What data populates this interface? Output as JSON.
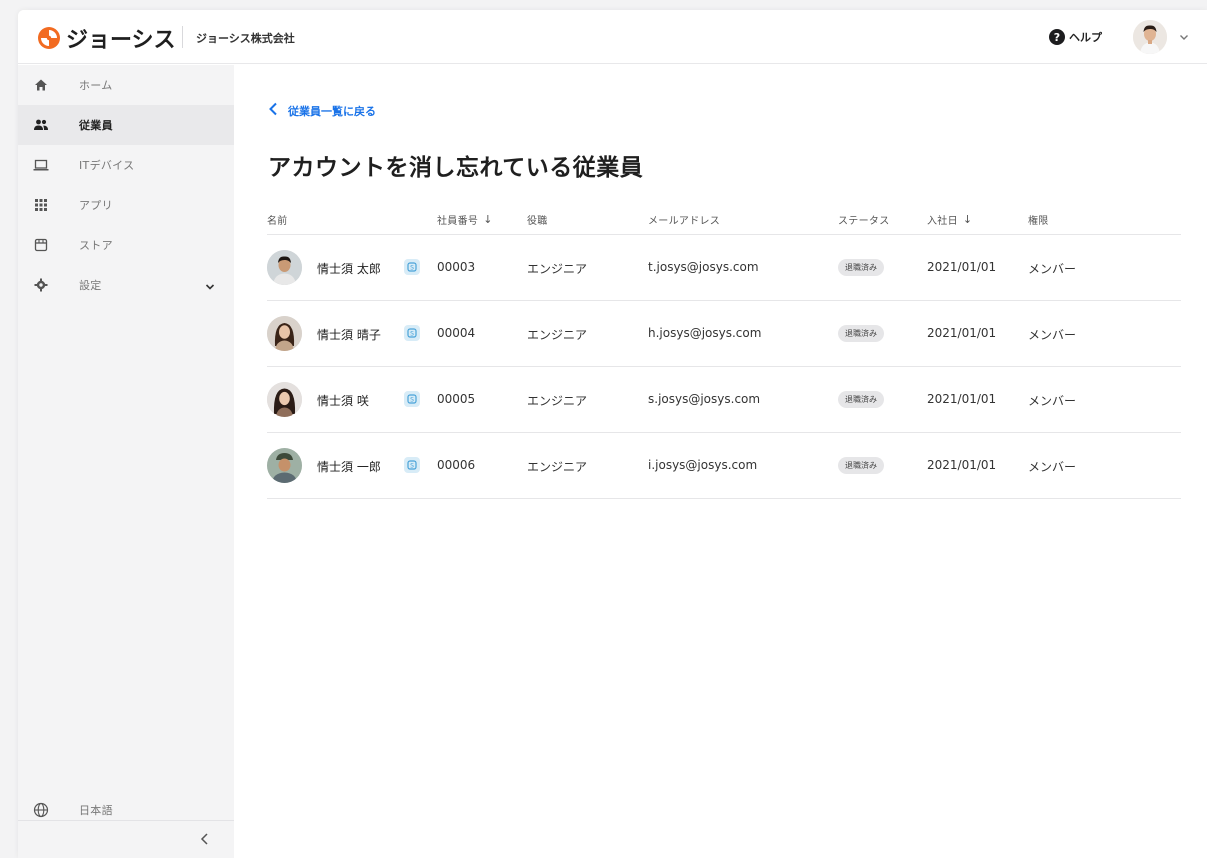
{
  "header": {
    "logo_text": "ジョーシス",
    "company": "ジョーシス株式会社",
    "help_label": "ヘルプ",
    "help_icon_glyph": "?"
  },
  "sidebar": {
    "items": [
      {
        "label": "ホーム",
        "icon": "home-icon"
      },
      {
        "label": "従業員",
        "icon": "people-icon",
        "active": true
      },
      {
        "label": "ITデバイス",
        "icon": "laptop-icon"
      },
      {
        "label": "アプリ",
        "icon": "apps-grid-icon"
      },
      {
        "label": "ストア",
        "icon": "store-icon"
      },
      {
        "label": "設定",
        "icon": "gear-icon",
        "expandable": true
      }
    ],
    "language": "日本語"
  },
  "main": {
    "back_link": "従業員一覧に戻る",
    "title": "アカウントを消し忘れている従業員",
    "columns": {
      "name": "名前",
      "employee_no": "社員番号",
      "role": "役職",
      "email": "メールアドレス",
      "status": "ステータス",
      "joined": "入社日",
      "permission": "権限",
      "sort_glyph": "↓"
    },
    "rows": [
      {
        "name": "情士須 太郎",
        "employee_no": "00003",
        "role": "エンジニア",
        "email": "t.josys@josys.com",
        "status": "退職済み",
        "joined": "2021/01/01",
        "permission": "メンバー"
      },
      {
        "name": "情士須 晴子",
        "employee_no": "00004",
        "role": "エンジニア",
        "email": "h.josys@josys.com",
        "status": "退職済み",
        "joined": "2021/01/01",
        "permission": "メンバー"
      },
      {
        "name": "情士須 咲",
        "employee_no": "00005",
        "role": "エンジニア",
        "email": "s.josys@josys.com",
        "status": "退職済み",
        "joined": "2021/01/01",
        "permission": "メンバー"
      },
      {
        "name": "情士須 一郎",
        "employee_no": "00006",
        "role": "エンジニア",
        "email": "i.josys@josys.com",
        "status": "退職済み",
        "joined": "2021/01/01",
        "permission": "メンバー"
      }
    ]
  },
  "colors": {
    "accent": "#1a73e8",
    "logo_orange": "#f26b21",
    "sidebar_bg": "#f4f4f5",
    "status_bg": "#e6e6e8"
  }
}
